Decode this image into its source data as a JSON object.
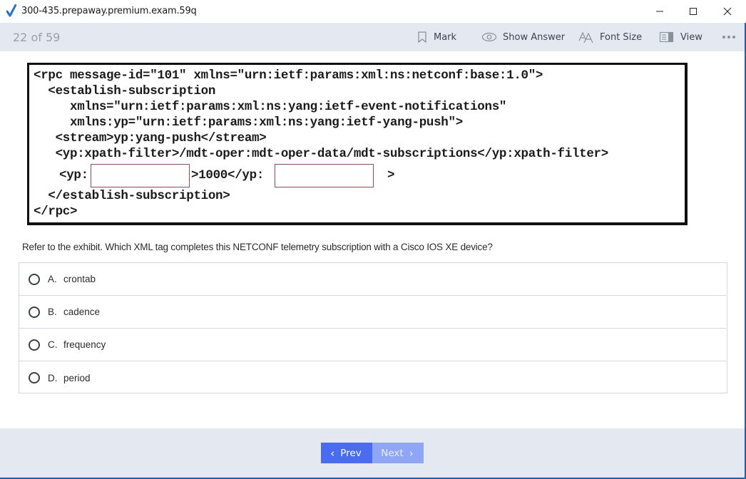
{
  "window": {
    "title": "300-435.prepaway.premium.exam.59q",
    "controls": {
      "minimize": "minimize",
      "maximize": "maximize",
      "close": "close"
    }
  },
  "toolbar": {
    "counter": "22 of 59",
    "mark_label": "Mark",
    "show_answer_label": "Show Answer",
    "font_size_label": "Font Size",
    "view_label": "View",
    "more_label": "•••"
  },
  "exhibit": {
    "lines": [
      "<rpc message-id=″101″ xmlns=″urn:ietf:params:xml:ns:netconf:base:1.0″>",
      "  <establish-subscription",
      "     xmlns=″urn:ietf:params:xml:ns:yang:ietf-event-notifications″",
      "     xmlns:yp=″urn:ietf:params:xml:ns:yang:ietf-yang-push″>",
      "   <stream>yp:yang-push</stream>",
      "   <yp:xpath-filter>/mdt-oper:mdt-oper-data/mdt-subscriptions</yp:xpath-filter>",
      "  </establish-subscription>",
      "</rpc>"
    ],
    "blank_line": {
      "prefix": "<yp:",
      "middle": ">1000</yp:",
      "suffix": ">"
    }
  },
  "question": {
    "text": "Refer to the exhibit. Which XML tag completes this NETCONF telemetry subscription with a Cisco IOS XE device?",
    "options": [
      {
        "letter": "A.",
        "text": "crontab"
      },
      {
        "letter": "B.",
        "text": "cadence"
      },
      {
        "letter": "C.",
        "text": "frequency"
      },
      {
        "letter": "D.",
        "text": "period"
      }
    ]
  },
  "footer": {
    "prev_label": "Prev",
    "next_label": "Next",
    "prev_chevron": "‹",
    "next_chevron": "›"
  },
  "colors": {
    "toolbar_bg": "#e4e8f1",
    "prev_button": "#4a6cf0",
    "next_button_disabled": "#8fa6f7",
    "blank_border": "#a2474f"
  }
}
